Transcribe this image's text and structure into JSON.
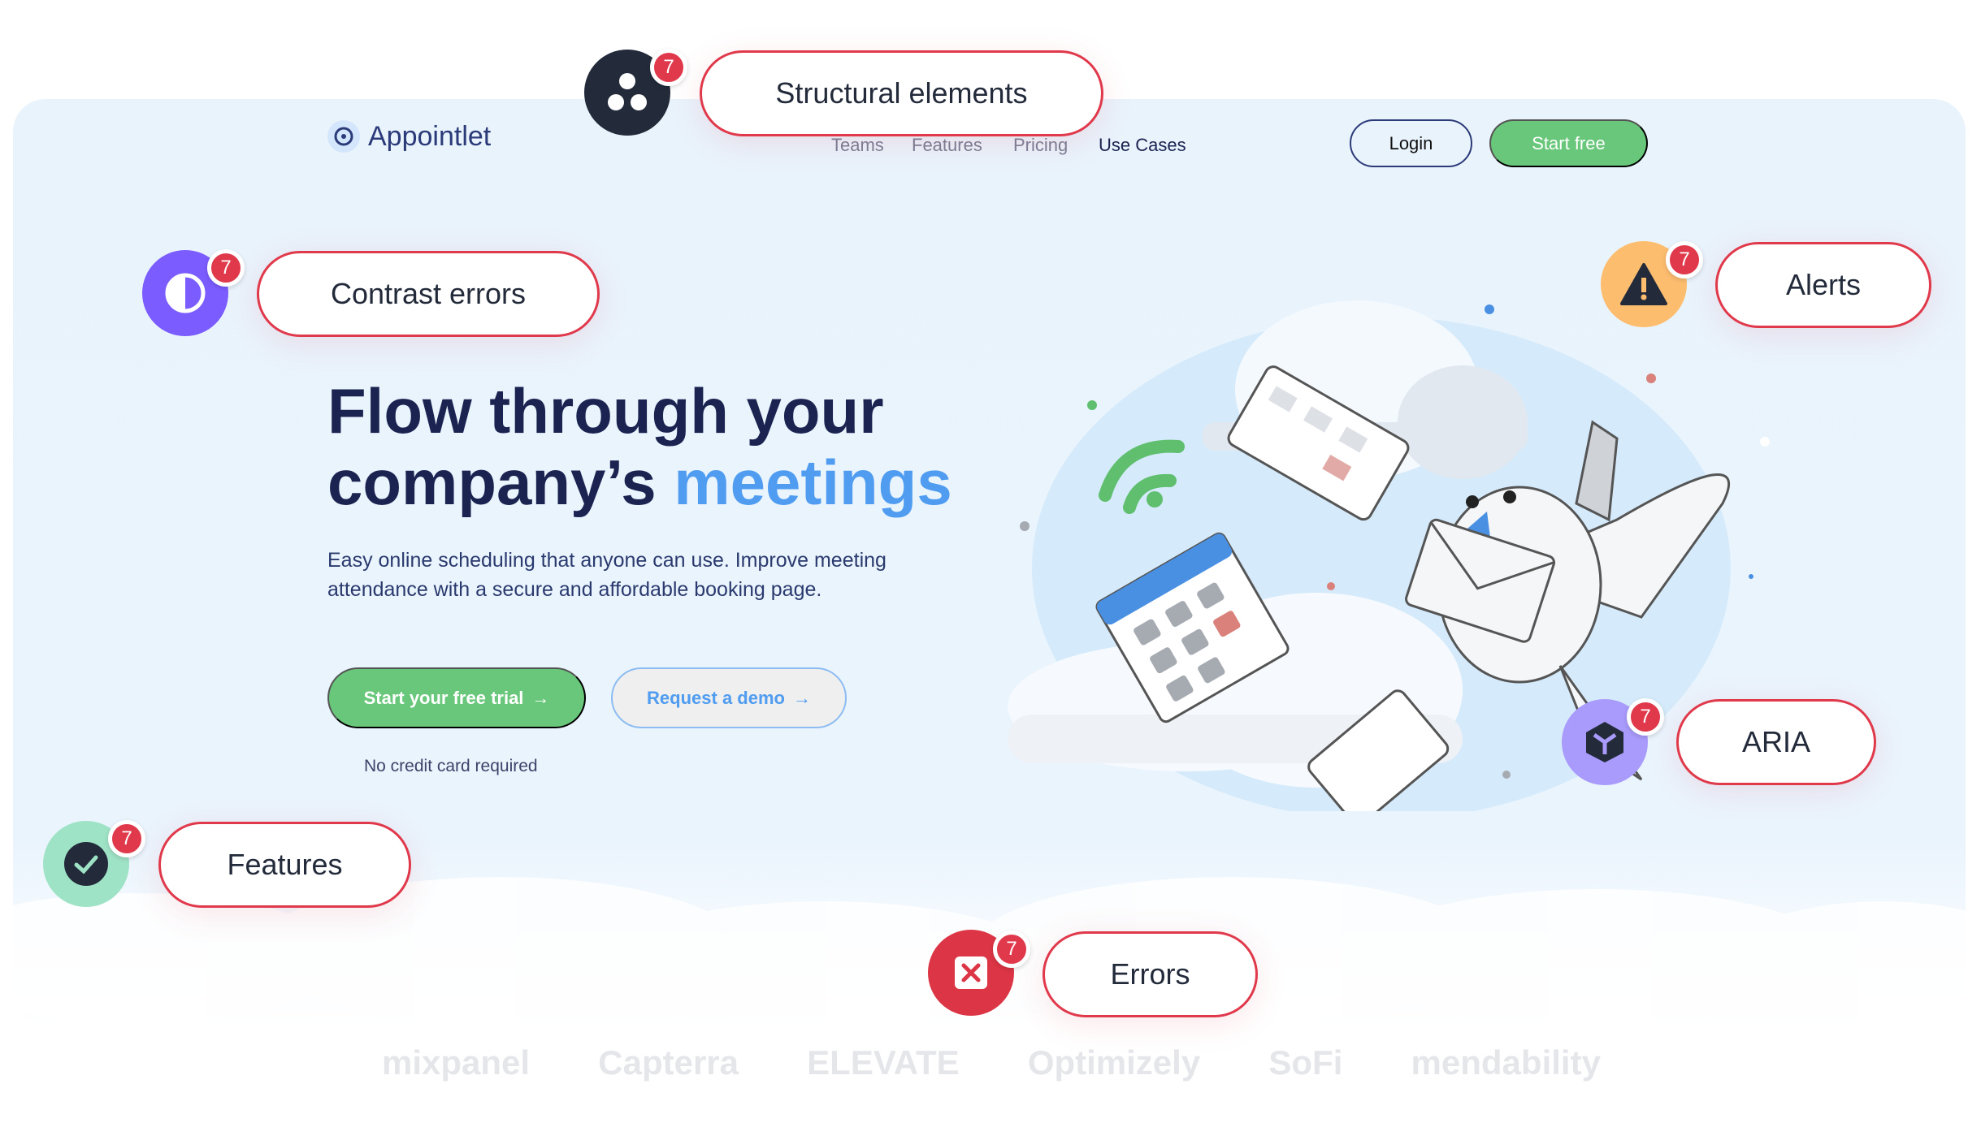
{
  "nav": {
    "brand": "Appointlet",
    "links": [
      "Teams",
      "Features",
      "Pricing",
      "Use Cases"
    ],
    "active": "Use Cases",
    "login": "Login",
    "start_free": "Start free"
  },
  "hero": {
    "title_line1": "Flow through your",
    "title_line2_prefix": "company’s ",
    "title_highlight": "meetings",
    "subtitle": "Easy online scheduling that anyone can use. Improve meeting attendance with a secure and affordable booking page.",
    "cta_primary": "Start your free trial",
    "cta_secondary": "Request a demo",
    "arrow": "→",
    "note": "No credit card required"
  },
  "customer_logos": [
    "mixpanel",
    "Capterra",
    "ELEVATE",
    "Optimizely",
    "SoFi",
    "mendability"
  ],
  "audit_markers": [
    {
      "label": "Structural elements",
      "count": "7",
      "icon": "structure-icon",
      "color": "#232b3b"
    },
    {
      "label": "Contrast errors",
      "count": "7",
      "icon": "contrast-icon",
      "color": "#7b5cff"
    },
    {
      "label": "Alerts",
      "count": "7",
      "icon": "warning-icon",
      "color": "#fdbd6f"
    },
    {
      "label": "ARIA",
      "count": "7",
      "icon": "aria-cube-icon",
      "color": "#a99bfb"
    },
    {
      "label": "Features",
      "count": "7",
      "icon": "check-icon",
      "color": "#9fe3c6"
    },
    {
      "label": "Errors",
      "count": "7",
      "icon": "error-x-icon",
      "color": "#dc3545"
    }
  ],
  "colors": {
    "accent_green": "#68c77a",
    "accent_blue": "#4f9cf0",
    "badge_red": "#e0394b",
    "navy": "#1b2451"
  }
}
